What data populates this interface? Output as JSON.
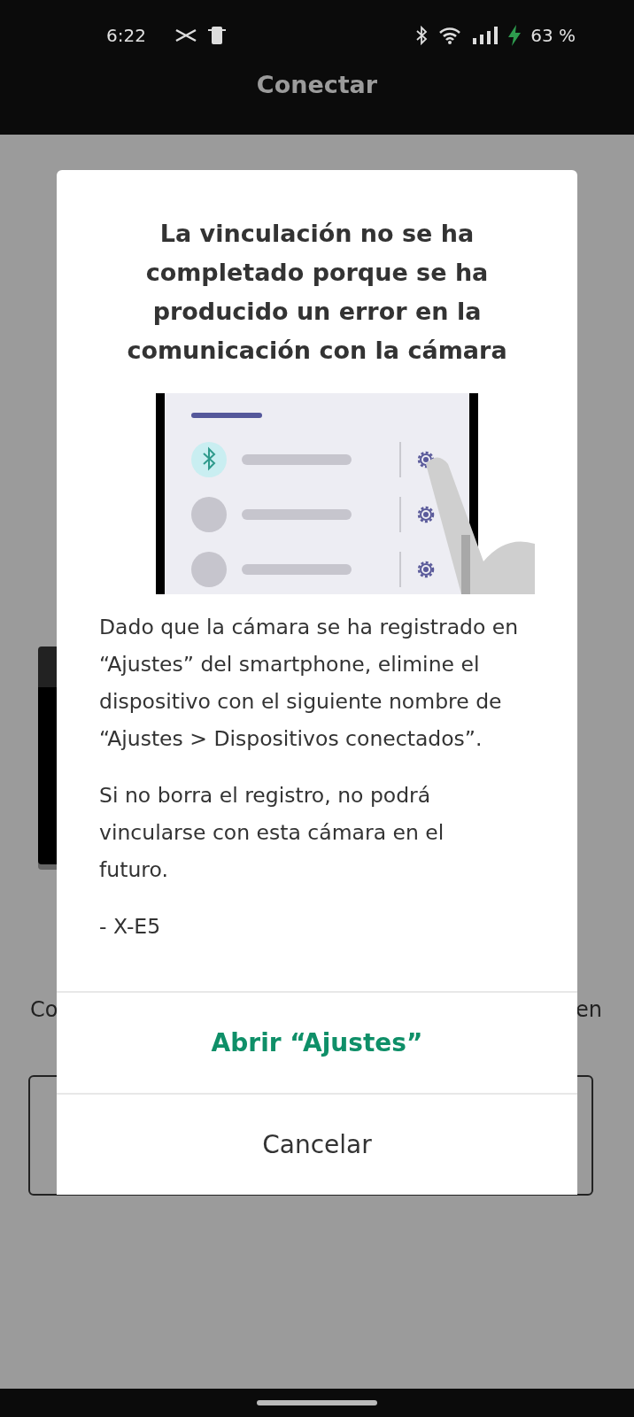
{
  "status_bar": {
    "time": "6:22",
    "battery": "63 %"
  },
  "app_bar": {
    "title": "Conectar"
  },
  "background": {
    "body_left": "Co",
    "body_right": "en"
  },
  "dialog": {
    "title": "La vinculación no se ha completado porque se ha producido un error en la comunicación con la cámara",
    "paragraphs": [
      "Dado que la cámara se ha registrado en “Ajustes” del smartphone, elimine el dispositivo con el siguiente nombre de “Ajustes > Dispositivos conectados”.",
      "Si no borra el registro, no podrá vincularse con esta cámara en el futuro.",
      "- X-E5"
    ],
    "buttons": [
      {
        "label": "Abrir “Ajustes”",
        "kind": "primary"
      },
      {
        "label": "Cancelar",
        "kind": "secondary"
      }
    ]
  }
}
